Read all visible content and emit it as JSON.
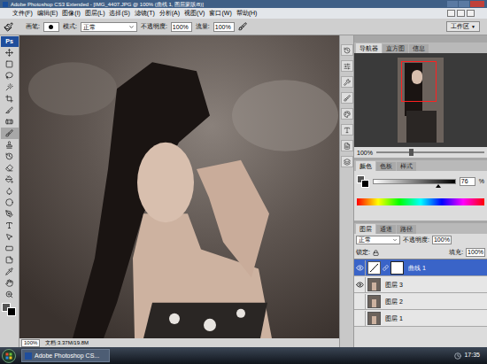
{
  "window": {
    "title": "Adobe Photoshop CS3 Extended - [IMG_4407.JPG @ 100% (曲线 1, 图层蒙版/8)]"
  },
  "menu": [
    "文件(F)",
    "编辑(E)",
    "图像(I)",
    "图层(L)",
    "选择(S)",
    "滤镜(T)",
    "分析(A)",
    "视图(V)",
    "窗口(W)",
    "帮助(H)"
  ],
  "options_bar": {
    "brush_label": "画笔:",
    "mode_label": "模式:",
    "mode": "正常",
    "opacity_label": "不透明度:",
    "opacity": "100%",
    "flow_label": "流量:",
    "flow": "100%",
    "workspace": "工作区",
    "workspace_arrow": "▼"
  },
  "toolbox": {
    "logo": "Ps"
  },
  "document": {
    "zoom": "100%",
    "info": "文档:3.37M/19.8M"
  },
  "navigator": {
    "tabs": [
      {
        "label": "导航器",
        "selected": true
      },
      {
        "label": "直方图",
        "selected": false
      },
      {
        "label": "信息",
        "selected": false
      }
    ],
    "zoom": "100%",
    "zoom_level": 0.3
  },
  "color": {
    "tabs": [
      {
        "label": "颜色",
        "selected": true
      },
      {
        "label": "色板",
        "selected": false
      },
      {
        "label": "样式",
        "selected": false
      }
    ],
    "slider": {
      "level": 0.76,
      "reading": "76",
      "unit": "%"
    }
  },
  "layers": {
    "tabs": [
      {
        "label": "图层",
        "selected": true
      },
      {
        "label": "通道",
        "selected": false
      },
      {
        "label": "路径",
        "selected": false
      }
    ],
    "blend_mode": "正常",
    "opacity_label": "不透明度:",
    "opacity": "100%",
    "lock_label": "锁定:",
    "fill_label": "填充:",
    "fill": "100%",
    "items": [
      {
        "name": "曲线 1",
        "selected": true,
        "visible": true,
        "kind": "adjustment"
      },
      {
        "name": "图层 3",
        "selected": false,
        "visible": true,
        "kind": "pixel"
      },
      {
        "name": "图层 2",
        "selected": false,
        "visible": false,
        "kind": "pixel"
      },
      {
        "name": "图层 1",
        "selected": false,
        "visible": false,
        "kind": "pixel"
      }
    ]
  },
  "taskbar": {
    "tasks": [
      {
        "label": "Adobe Photoshop CS...",
        "selected": true
      }
    ],
    "clock": "17:35"
  }
}
